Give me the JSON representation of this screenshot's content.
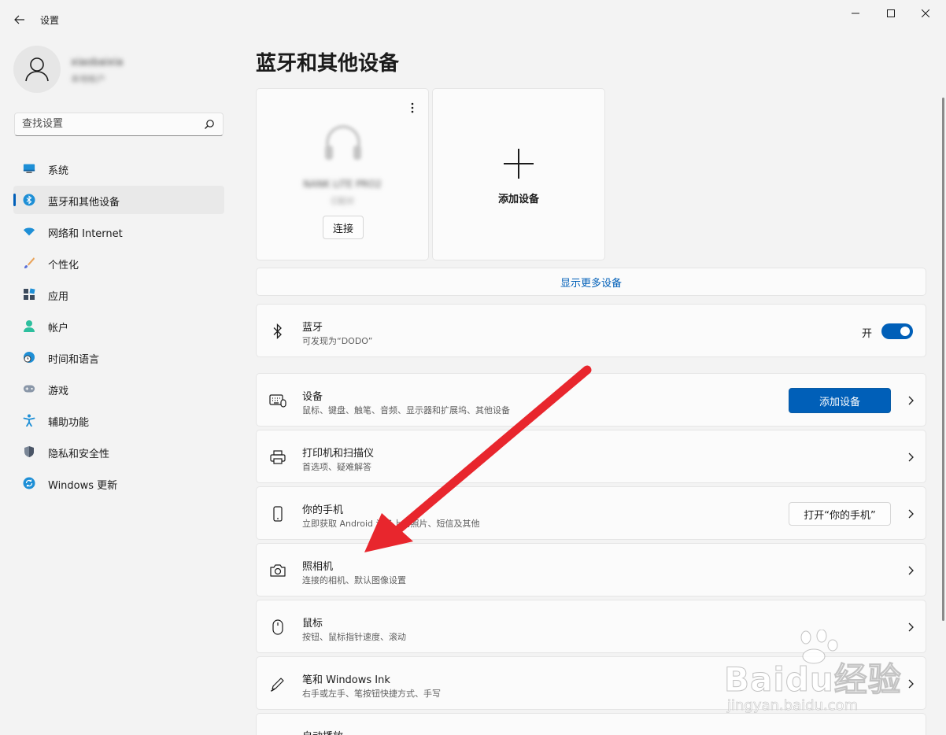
{
  "window": {
    "title": "设置"
  },
  "user": {
    "name": "xiaobaixia",
    "account": "本地帐户"
  },
  "search": {
    "placeholder": "查找设置"
  },
  "nav": {
    "items": [
      {
        "label": "系统"
      },
      {
        "label": "蓝牙和其他设备"
      },
      {
        "label": "网络和 Internet"
      },
      {
        "label": "个性化"
      },
      {
        "label": "应用"
      },
      {
        "label": "帐户"
      },
      {
        "label": "时间和语言"
      },
      {
        "label": "游戏"
      },
      {
        "label": "辅助功能"
      },
      {
        "label": "隐私和安全性"
      },
      {
        "label": "Windows 更新"
      }
    ]
  },
  "main": {
    "title": "蓝牙和其他设备",
    "device_card": {
      "name": "NANK LITE PRO2",
      "status": "已配对",
      "connect_label": "连接"
    },
    "add_card": {
      "label": "添加设备"
    },
    "show_more": "显示更多设备",
    "bluetooth": {
      "title": "蓝牙",
      "subtitle": "可发现为“DODO”",
      "toggle_label": "开"
    },
    "rows": [
      {
        "title": "设备",
        "subtitle": "鼠标、键盘、触笔、音频、显示器和扩展坞、其他设备",
        "button": "添加设备"
      },
      {
        "title": "打印机和扫描仪",
        "subtitle": "首选项、疑难解答"
      },
      {
        "title": "你的手机",
        "subtitle": "立即获取 Android 设备上的照片、短信及其他",
        "button": "打开“你的手机”"
      },
      {
        "title": "照相机",
        "subtitle": "连接的相机、默认图像设置"
      },
      {
        "title": "鼠标",
        "subtitle": "按钮、鼠标指针速度、滚动"
      },
      {
        "title": "笔和 Windows Ink",
        "subtitle": "右手或左手、笔按钮快捷方式、手写"
      },
      {
        "title": "自动播放",
        "subtitle": ""
      }
    ]
  },
  "watermark": {
    "brand": "Baidu经验",
    "url": "jingyan.baidu.com"
  },
  "colors": {
    "accent": "#005fb8",
    "arrow": "#e8262d",
    "background": "#f3f3f3"
  }
}
